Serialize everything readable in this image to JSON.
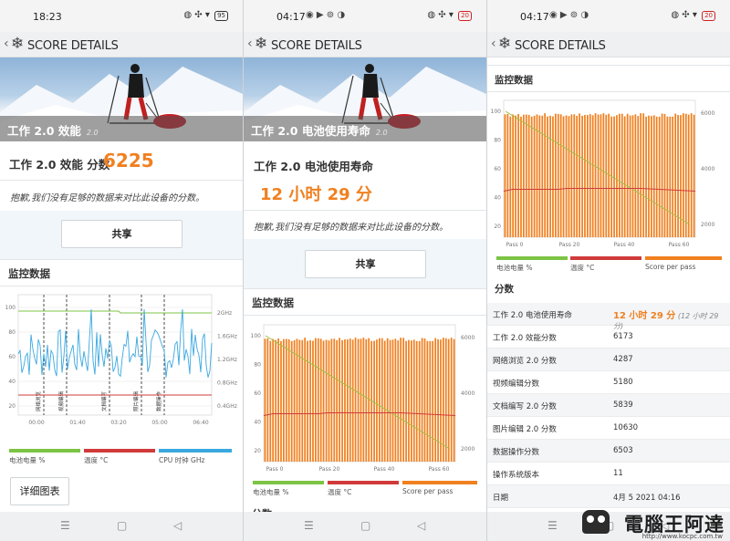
{
  "colors": {
    "accent": "#f08020",
    "battery": "#7cc444",
    "temp": "#d03a3a",
    "cpu": "#3aa8e0",
    "score": "#f08020",
    "trend": "#a0c040"
  },
  "panel1": {
    "status": {
      "time": "18:23",
      "battery": "95"
    },
    "header": "SCORE DETAILS",
    "hero_title": "工作 2.0 效能",
    "hero_version": "2.0",
    "score_label": "工作 2.0 效能 分数",
    "score_value": "6225",
    "message": "抱歉,我们没有足够的数据来对比此设备的分数。",
    "share": "共享",
    "monitor_title": "监控数据",
    "chart": {
      "y_left": [
        "100",
        "80",
        "60",
        "40",
        "20"
      ],
      "y_right": [
        "2GHz",
        "1.6GHz",
        "1.2GHz",
        "0.8GHz",
        "0.4GHz"
      ],
      "x": [
        "00:00",
        "01:40",
        "03:20",
        "05:00",
        "06:40"
      ],
      "markers": [
        "网络浏览",
        "视频编辑",
        "文档编写",
        "照片编辑",
        "数据操作"
      ]
    },
    "legend": [
      "电池电量 %",
      "温度 °C",
      "CPU 时钟 GHz"
    ],
    "detail": "详细图表"
  },
  "panel2": {
    "status": {
      "time": "04:17",
      "battery": "20"
    },
    "header": "SCORE DETAILS",
    "hero_title": "工作 2.0 电池使用寿命",
    "hero_version": "2.0",
    "score_label": "工作 2.0 电池使用寿命",
    "score_value": "12 小时 29 分",
    "message": "抱歉,我们没有足够的数据来对比此设备的分数。",
    "share": "共享",
    "monitor_title": "监控数据",
    "chart": {
      "y_left": [
        "100",
        "80",
        "60",
        "40",
        "20"
      ],
      "y_right": [
        "6000",
        "4000",
        "2000"
      ],
      "x": [
        "Pass 0",
        "Pass 20",
        "Pass 40",
        "Pass 60"
      ]
    },
    "legend": [
      "电池电量 %",
      "温度 °C",
      "Score per pass"
    ],
    "scores_title": "分数"
  },
  "panel3": {
    "status": {
      "time": "04:17",
      "battery": "20"
    },
    "header": "SCORE DETAILS",
    "monitor_title": "监控数据",
    "chart": {
      "y_left": [
        "100",
        "80",
        "60",
        "40",
        "20"
      ],
      "y_right": [
        "6000",
        "4000",
        "2000"
      ],
      "x": [
        "Pass 0",
        "Pass 20",
        "Pass 40",
        "Pass 60"
      ]
    },
    "legend": [
      "电池电量 %",
      "温度 °C",
      "Score per pass"
    ],
    "scores_title": "分数",
    "rows": [
      {
        "k": "工作 2.0 电池使用寿命",
        "v": "12 小时 29 分",
        "note": "(12 小时 29 分)"
      },
      {
        "k": "工作 2.0 效能分数",
        "v": "6173"
      },
      {
        "k": "网络浏览 2.0 分数",
        "v": "4287"
      },
      {
        "k": "视频编辑分数",
        "v": "5180"
      },
      {
        "k": "文档编写 2.0 分数",
        "v": "5839"
      },
      {
        "k": "图片编辑 2.0 分数",
        "v": "10630"
      },
      {
        "k": "数据操作分数",
        "v": "6503"
      },
      {
        "k": "操作系统版本",
        "v": "11"
      },
      {
        "k": "日期",
        "v": "4月 5 2021 04:16"
      }
    ]
  },
  "watermark": {
    "brand": "電腦王阿達",
    "url": "http://www.kocpc.com.tw"
  }
}
